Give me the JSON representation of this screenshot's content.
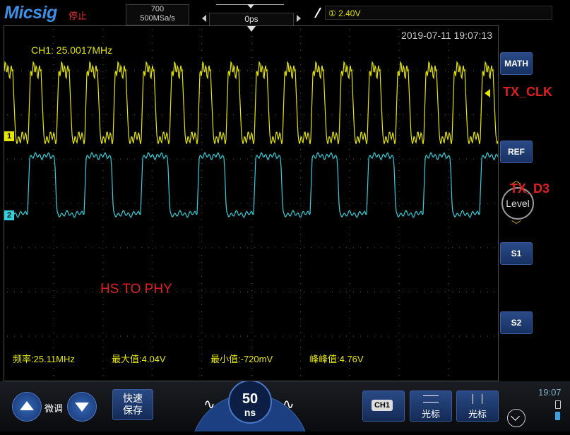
{
  "topbar": {
    "logo": "Micsig",
    "run_status": "停止",
    "memory_depth": "700",
    "sample_rate": "500MSa/s",
    "time_offset": "0ps",
    "trigger_level": "① 2.40V"
  },
  "scope": {
    "timestamp": "2019-07-11 19:07:13",
    "ch1_frequency": "CH1: 25.0017MHz",
    "annotation": "HS TO PHY",
    "ch1_marker": "1",
    "ch2_marker": "2",
    "measurements": [
      {
        "label": "频率:25.11MHz"
      },
      {
        "label": "最大值:4.04V"
      },
      {
        "label": "最小值:-720mV"
      },
      {
        "label": "峰峰值:4.76V"
      }
    ],
    "channel_colors": {
      "ch1": "#e6e600",
      "ch2": "#33d0dc"
    }
  },
  "right_panel": {
    "math": "MATH",
    "ref": "REF",
    "level": "Level",
    "s1": "S1",
    "s2": "S2",
    "tx_clk_label": "TX_CLK",
    "tx_d3_label": "TX_D3"
  },
  "bottombar": {
    "fine_tune": "微调",
    "quick_save_line1": "快速",
    "quick_save_line2": "保存",
    "timebase_value": "50",
    "timebase_unit": "ns",
    "ch1_button": "CH1",
    "cursor1": "光标",
    "cursor2": "光标",
    "clock": "19:07"
  }
}
